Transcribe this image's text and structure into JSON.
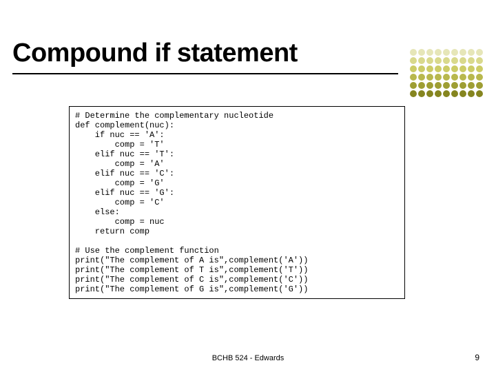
{
  "title": "Compound if statement",
  "code": "# Determine the complementary nucleotide\ndef complement(nuc):\n    if nuc == 'A':\n        comp = 'T'\n    elif nuc == 'T':\n        comp = 'A'\n    elif nuc == 'C':\n        comp = 'G'\n    elif nuc == 'G':\n        comp = 'C'\n    else:\n        comp = nuc\n    return comp\n\n# Use the complement function\nprint(\"The complement of A is\",complement('A'))\nprint(\"The complement of T is\",complement('T'))\nprint(\"The complement of C is\",complement('C'))\nprint(\"The complement of G is\",complement('G'))",
  "footer": "BCHB 524 - Edwards",
  "page_number": "9",
  "dot_colors": {
    "row1": "#e6e6b8",
    "row2": "#d9d98c",
    "row3": "#cccc66",
    "row4": "#b8b84d",
    "row5": "#9e9e33",
    "row6": "#85851f"
  }
}
